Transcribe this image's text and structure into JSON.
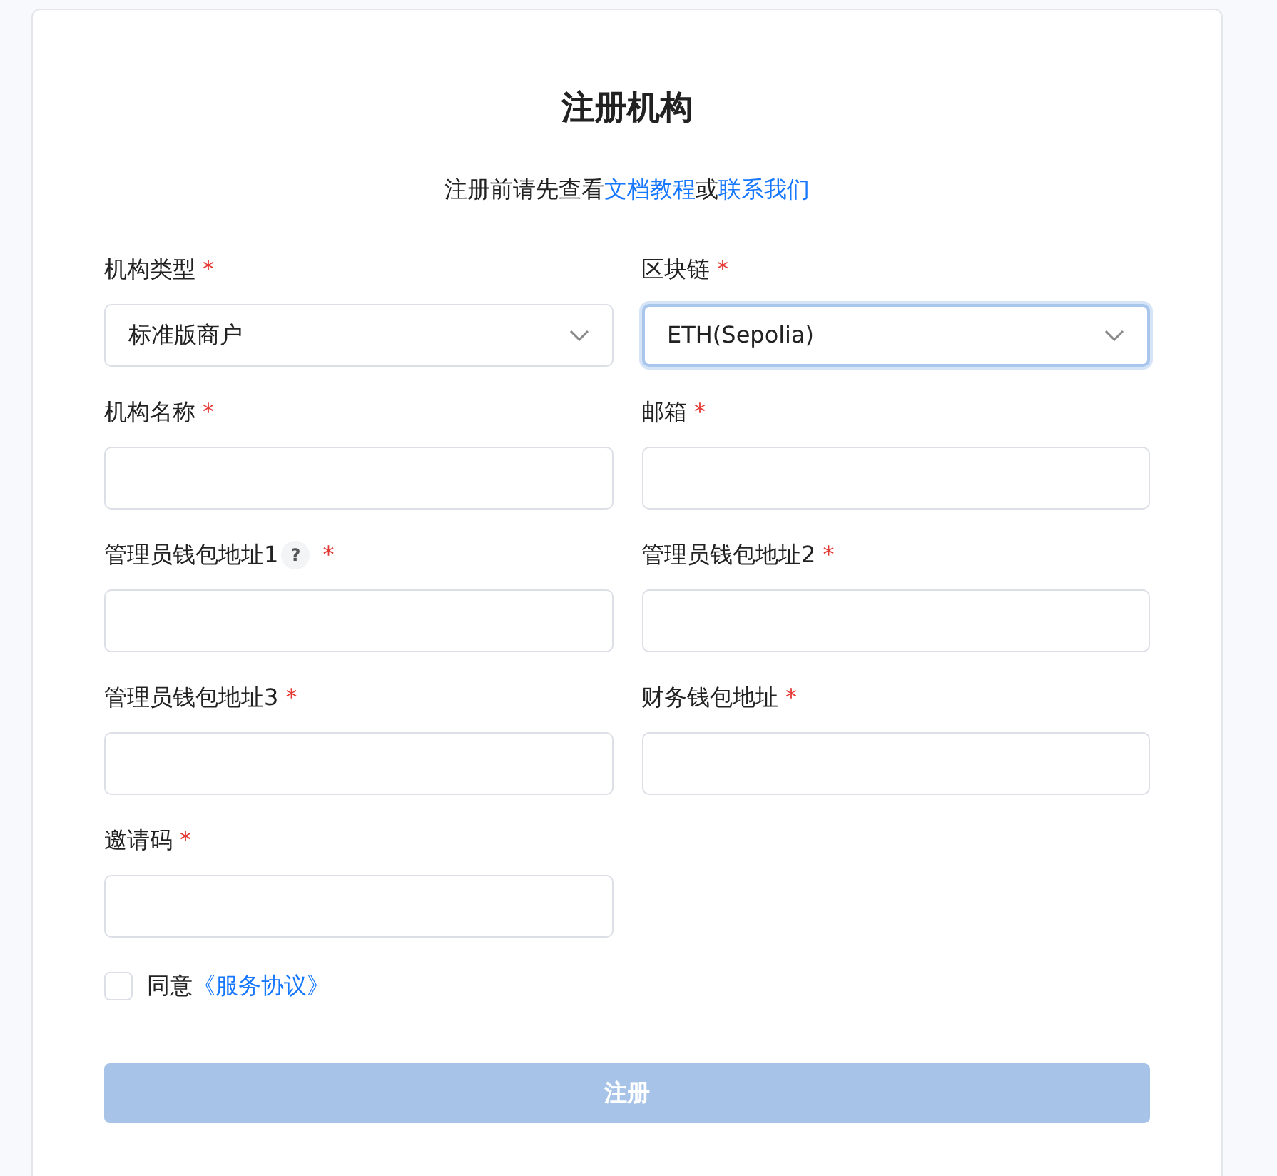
{
  "title": "注册机构",
  "subtitle": [
    {
      "kind": "text",
      "text": "注册前请先查看"
    },
    {
      "kind": "link",
      "text": "文档教程"
    },
    {
      "kind": "text",
      "text": "或"
    },
    {
      "kind": "link",
      "text": "联系我们"
    }
  ],
  "fields": [
    {
      "kind": "select",
      "label": "机构类型",
      "required_mark": "*",
      "value": "标准版商户",
      "focused": false
    },
    {
      "kind": "select",
      "label": "区块链",
      "required_mark": "*",
      "value": "ETH(Sepolia)",
      "focused": true
    },
    {
      "kind": "input",
      "label": "机构名称",
      "required_mark": "*",
      "focused": false
    },
    {
      "kind": "input",
      "label": "邮箱",
      "required_mark": "*",
      "focused": false
    },
    {
      "kind": "input",
      "label": "管理员钱包地址1",
      "help": "?",
      "required_mark": "*",
      "focused": false
    },
    {
      "kind": "input",
      "label": "管理员钱包地址2",
      "required_mark": "*",
      "focused": false
    },
    {
      "kind": "input",
      "label": "管理员钱包地址3",
      "required_mark": "*",
      "focused": false
    },
    {
      "kind": "input",
      "label": "财务钱包地址",
      "required_mark": "*",
      "focused": false
    },
    {
      "kind": "input",
      "label": "邀请码",
      "required_mark": "*",
      "focused": false
    }
  ],
  "agreement": {
    "checked": false,
    "text": "同意",
    "link": "《服务协议》"
  },
  "submit": {
    "label": "注册",
    "disabled": true
  }
}
